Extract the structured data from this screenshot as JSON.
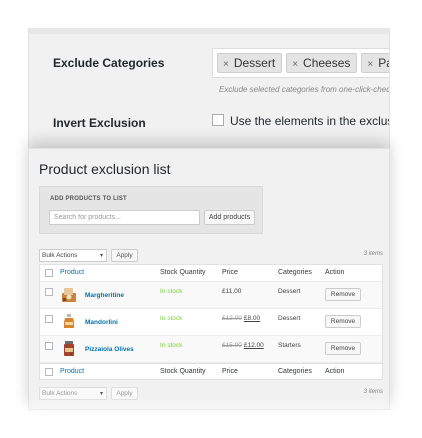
{
  "settings": {
    "exclude_categories_label": "Exclude Categories",
    "selected_categories": [
      "Dessert",
      "Cheeses",
      "Pasta"
    ],
    "remove_tag_glyph": "×",
    "exclude_help_text": "Exclude selected categories from one-click-checkout fea",
    "invert_exclusion_label": "Invert Exclusion",
    "invert_checkbox_text": "Use the elements in the exclusion l",
    "invert_checked": false
  },
  "exclusion_list": {
    "title": "Product exclusion list",
    "add_section_label": "ADD PRODUCTS TO LIST",
    "search_placeholder": "Search for products...",
    "add_button_label": "Add products",
    "bulk_actions_label": "Bulk Actions",
    "bulk_caret": "▾",
    "apply_label": "Apply",
    "items_count_text": "3 items",
    "columns": [
      "Product",
      "Stock Quantity",
      "Price",
      "Categories",
      "Action"
    ],
    "rows": [
      {
        "name": "Margheritine",
        "stock": "In stock",
        "price_regular": "£11.00",
        "price_sale": "",
        "category": "Dessert",
        "action_label": "Remove",
        "thumb_icon": "biscuit-box-icon",
        "thumb_color": "#c8843f"
      },
      {
        "name": "Mandorlini",
        "stock": "In stock",
        "price_regular": "£12.00",
        "price_sale": "£8.00",
        "category": "Dessert",
        "action_label": "Remove",
        "thumb_icon": "candy-jar-icon",
        "thumb_color": "#d9842c"
      },
      {
        "name": "Pizzaiola Olives",
        "stock": "In stock",
        "price_regular": "£15.00",
        "price_sale": "£12.00",
        "category": "Starters",
        "action_label": "Remove",
        "thumb_icon": "olive-jar-icon",
        "thumb_color": "#a8402c"
      }
    ]
  },
  "colors": {
    "link": "#0073aa",
    "in_stock": "#7ad03a"
  }
}
